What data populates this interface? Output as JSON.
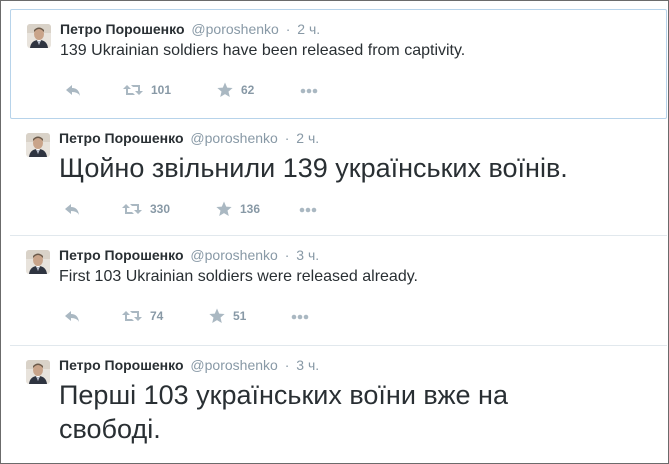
{
  "tweets": [
    {
      "fullname": "Петро Порошенко",
      "handle": "@poroshenko",
      "separator": "·",
      "time": "2 ч.",
      "text": "139 Ukrainian soldiers have been released from captivity.",
      "retweets": "101",
      "favorites": "62"
    },
    {
      "fullname": "Петро Порошенко",
      "handle": "@poroshenko",
      "separator": "·",
      "time": "2 ч.",
      "text": "Щойно звільнили 139 українських воїнів.",
      "retweets": "330",
      "favorites": "136"
    },
    {
      "fullname": "Петро Порошенко",
      "handle": "@poroshenko",
      "separator": "·",
      "time": "3 ч.",
      "text": "First 103 Ukrainian soldiers were released already.",
      "retweets": "74",
      "favorites": "51"
    },
    {
      "fullname": "Петро Порошенко",
      "handle": "@poroshenko",
      "separator": "·",
      "time": "3 ч.",
      "text": "Перші 103 українських воїни вже на свободі."
    }
  ],
  "colors": {
    "name": "#292f33",
    "muted": "#8899a6",
    "icon": "#aab8c2",
    "divider": "#e1e8ed",
    "highlight_border": "#b7d3ea"
  },
  "icons": [
    "reply-icon",
    "retweet-icon",
    "favorite-star-icon",
    "more-icon"
  ]
}
